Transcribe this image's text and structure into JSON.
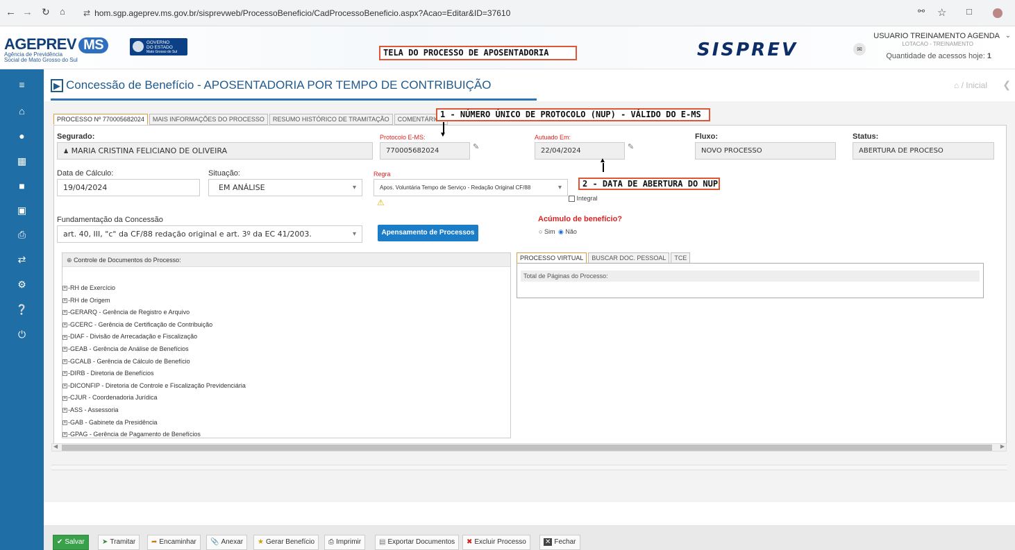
{
  "browser": {
    "url": "hom.sgp.ageprev.ms.gov.br/sisprevweb/ProcessoBeneficio/CadProcessoBeneficio.aspx?Acao=Editar&ID=37610"
  },
  "header": {
    "logo_main": "AGEPREV",
    "logo_ms": "MS",
    "logo_sub1": "Agência de Previdência",
    "logo_sub2": "Social de Mato Grosso do Sul",
    "gov_line1": "GOVERNO",
    "gov_line2": "DO ESTADO",
    "gov_line3": "Mato Grosso do Sul",
    "annotation_title": "TELA DO PROCESSO DE APOSENTADORIA",
    "system_name": "SISPREV",
    "user_name": "USUARIO TREINAMENTO AGENDA",
    "user_lotacao": "LOTACAO - TREINAMENTO",
    "access_label": "Quantidade de acessos hoje:",
    "access_count": "1"
  },
  "page": {
    "title": "Concessão de Benefício - APOSENTADORIA POR TEMPO DE CONTRIBUIÇÃO",
    "breadcrumb": "/ Inicial"
  },
  "tabs": [
    "PROCESSO Nº 770005682024",
    "MAIS INFORMAÇÕES DO PROCESSO",
    "RESUMO HISTÓRICO DE TRAMITAÇÃO",
    "COMENTÁRIOS"
  ],
  "annotations": {
    "nup": "1 - NÚMERO ÚNICO DE PROTOCOLO (NUP) - VÁLIDO DO E-MS",
    "date": "2 - DATA DE ABERTURA DO NUP"
  },
  "form": {
    "segurado_label": "Segurado:",
    "segurado_value": "MARIA CRISTINA FELICIANO DE OLIVEIRA",
    "protocolo_label": "Protocolo E-MS:",
    "protocolo_value": "770005682024",
    "autuado_label": "Autuado Em:",
    "autuado_value": "22/04/2024",
    "fluxo_label": "Fluxo:",
    "fluxo_value": "NOVO PROCESSO",
    "status_label": "Status:",
    "status_value": "ABERTURA DE PROCESO",
    "data_calculo_label": "Data de Cálculo:",
    "data_calculo_value": "19/04/2024",
    "situacao_label": "Situação:",
    "situacao_value": "EM ANÁLISE",
    "regra_label": "Regra",
    "regra_value": "Apos. Voluntária Tempo de Serviço - Redação Original CF/88",
    "integral_label": "Integral",
    "fundamentacao_label": "Fundamentação da Concessão",
    "fundamentacao_value": "art. 40, III, \"c\" da CF/88 redação original e art. 3º da EC 41/2003.",
    "apensamento_button": "Apensamento de Processos",
    "acumulo_label": "Acúmulo de benefício?",
    "sim_label": "Sim",
    "nao_label": "Não"
  },
  "documents": {
    "header": "Controle de Documentos do Processo:",
    "items": [
      "-RH de Exercício",
      "-RH de Origem",
      "-GERARQ - Gerência de Registro e Arquivo",
      "-GCERC - Gerência de Certificação de Contribuição",
      "-DIAF - Divisão de Arrecadação e Fiscalização",
      "-GEAB - Gerência de Análise de Benefícios",
      "-GCALB - Gerência de Cálculo de Benefício",
      "-DIRB - Diretoria de Benefícios",
      "-DICONFIP - Diretoria de Controle e Fiscalização Previdenciária",
      "-CJUR - Coordenadoria Jurídica",
      "-ASS - Assessoria",
      "-GAB - Gabinete da Presidência",
      "-GPAG - Gerência de Pagamento de Benefícios"
    ]
  },
  "right_panel": {
    "tabs": [
      "PROCESSO VIRTUAL",
      "BUSCAR DOC. PESSOAL",
      "TCE"
    ],
    "total_label": "Total de Páginas do Processo:"
  },
  "footer": {
    "buttons": [
      "Salvar",
      "Tramitar",
      "Encaminhar",
      "Anexar",
      "Gerar Benefício",
      "Imprimir",
      "Exportar Documentos",
      "Excluir Processo",
      "Fechar"
    ]
  },
  "colors": {
    "sidebar": "#1f6ea6",
    "accent": "#1b7dc8",
    "annotation_border": "#e05533",
    "save_button": "#3aa04a",
    "required_label": "#e02020"
  }
}
